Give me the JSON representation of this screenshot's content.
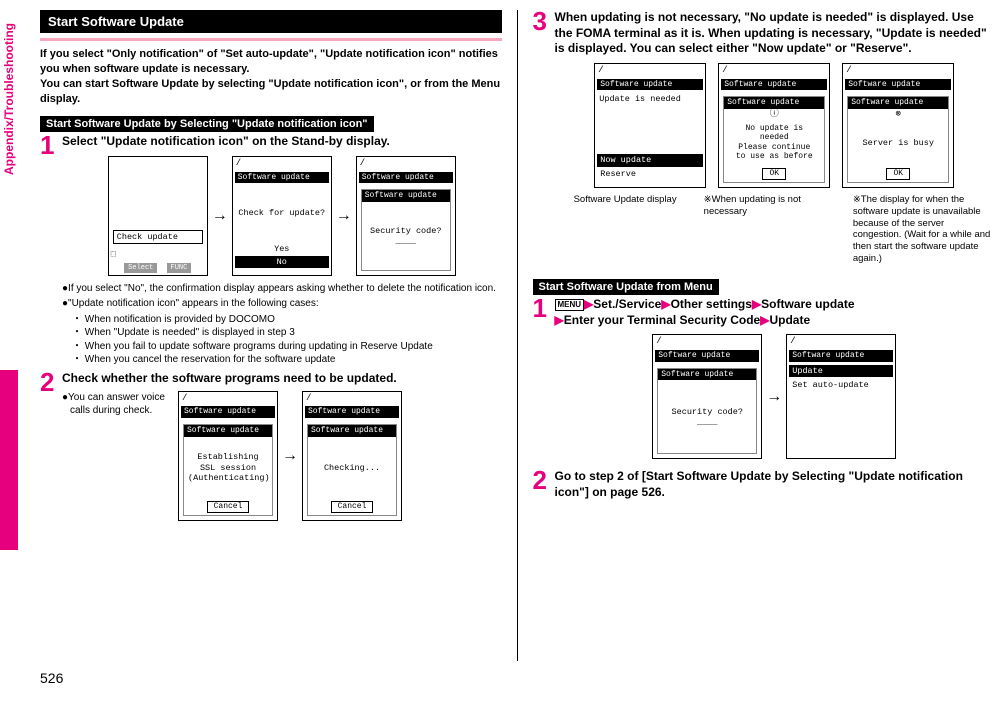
{
  "sideTab": "Appendix/Troubleshooting",
  "pageNum": "526",
  "left": {
    "header": "Start Software Update",
    "intro": "If you select \"Only notification\" of \"Set auto-update\", \"Update notification icon\" notifies you when software update is necessary.\nYou can start Software Update by selecting \"Update notification icon\", or from the Menu display.",
    "sub1": "Start Software Update by Selecting \"Update notification icon\"",
    "s1": {
      "num": "1",
      "title": "Select \"Update notification icon\" on the Stand-by display.",
      "scrA": {
        "row": "Check update",
        "soft1": "Select",
        "soft2": "FUNC"
      },
      "scrB": {
        "title": "Software update",
        "body": "Check for update?",
        "opt1": "Yes",
        "opt2": "No"
      },
      "scrC": {
        "title": "Software update",
        "sub": "Software update",
        "body": "Security code?",
        "line": "____"
      },
      "b1": "●If you select \"No\", the confirmation display appears asking whether to delete the notification icon.",
      "b2": "●\"Update notification icon\" appears in the following cases:",
      "sb1": "・ When notification is provided by DOCOMO",
      "sb2": "・ When \"Update is needed\" is displayed in step 3",
      "sb3": "・ When you fail to update software programs during updating in Reserve Update",
      "sb4": "・ When you cancel the reservation for the software update"
    },
    "s2": {
      "num": "2",
      "title": "Check whether the software programs need to be updated.",
      "note": "●You can answer voice calls during check.",
      "scrA": {
        "title": "Software update",
        "sub": "Software update",
        "body": "Establishing\nSSL session\n(Authenticating)",
        "btn": "Cancel"
      },
      "scrB": {
        "title": "Software update",
        "sub": "Software update",
        "body": "Checking...",
        "btn": "Cancel"
      }
    }
  },
  "right": {
    "s3": {
      "num": "3",
      "title": "When updating is not necessary, \"No update is needed\" is displayed. Use the FOMA terminal as it is. When updating is necessary, \"Update is needed\" is displayed. You can select either \"Now update\" or \"Reserve\".",
      "scrA": {
        "title": "Software update",
        "line1": "Update is needed",
        "opt1": "Now update",
        "opt2": "Reserve"
      },
      "scrB": {
        "title": "Software update",
        "sub": "Software update",
        "icon": "ⓘ",
        "body": "No update is\nneeded\nPlease continue\nto use as before",
        "btn": "OK"
      },
      "scrC": {
        "title": "Software update",
        "sub": "Software update",
        "icon": "⊗",
        "body": "Server is busy",
        "btn": "OK"
      },
      "cap1": "Software Update display",
      "cap2": "※When updating is not necessary",
      "cap3": "※The display for when the software update is unavailable because of the server congestion. (Wait for a while and then start the software update again.)"
    },
    "sub2": "Start Software Update from Menu",
    "s1b": {
      "num": "1",
      "menuLabel": "MENU",
      "p1": "Set./Service",
      "p2": "Other settings",
      "p3": "Software update",
      "p4": "Enter your Terminal Security Code",
      "p5": "Update",
      "scrA": {
        "title": "Software update",
        "sub": "Software update",
        "body": "Security code?",
        "line": "____"
      },
      "scrB": {
        "title": "Software update",
        "opt1": "Update",
        "opt2": "Set auto-update"
      }
    },
    "s2b": {
      "num": "2",
      "title": "Go to step 2 of [Start Software Update by Selecting \"Update notification icon\"] on page 526."
    }
  }
}
